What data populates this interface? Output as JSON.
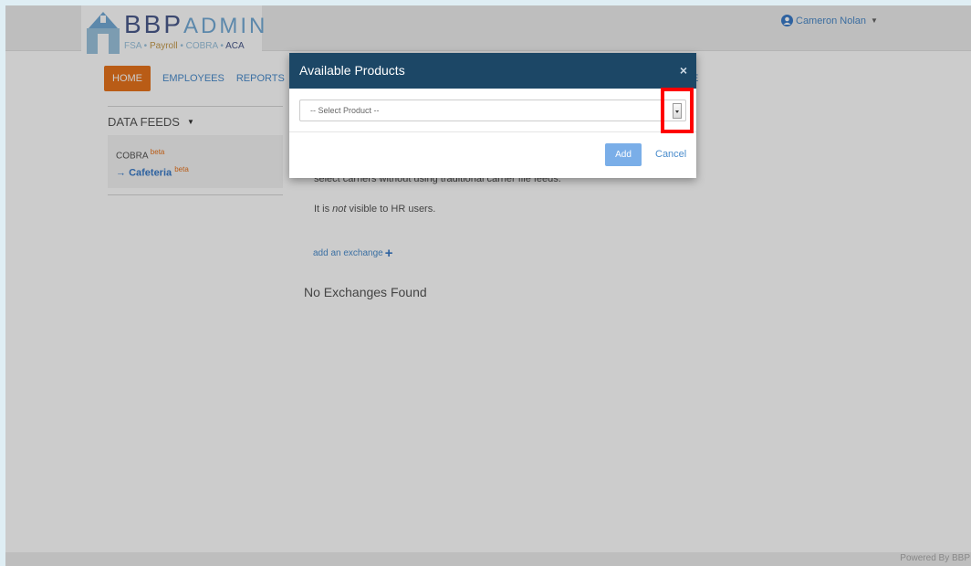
{
  "header": {
    "logo_main": "BBP",
    "logo_admin": "ADMIN",
    "logo_sub_fsa": "FSA",
    "logo_sub_payroll": "Payroll",
    "logo_sub_cobra": "COBRA",
    "logo_sub_aca": "ACA",
    "user_name": "Cameron Nolan"
  },
  "nav": {
    "items": [
      "HOME",
      "EMPLOYEES",
      "REPORTS"
    ],
    "tail": "E"
  },
  "sidebar": {
    "title": "DATA FEEDS",
    "items": [
      {
        "label": "COBRA",
        "badge": "beta"
      },
      {
        "label": "Cafeteria",
        "badge": "beta",
        "arrow": "→"
      }
    ]
  },
  "main": {
    "desc_line": "select carriers without using traditional carrier file feeds.",
    "visibility_prefix": "It is ",
    "visibility_em": "not",
    "visibility_suffix": " visible to HR users.",
    "add_exchange": "add an exchange",
    "no_exchanges": "No Exchanges Found"
  },
  "modal": {
    "title": "Available Products",
    "close": "×",
    "select_placeholder": "-- Select Product --",
    "add_label": "Add",
    "cancel_label": "Cancel"
  },
  "footer": {
    "powered_by": "Powered By BBP"
  },
  "colors": {
    "accent_orange": "#e8731c",
    "modal_header": "#1c4766",
    "link_blue": "#4a8ccc",
    "highlight_red": "#ff0000"
  }
}
